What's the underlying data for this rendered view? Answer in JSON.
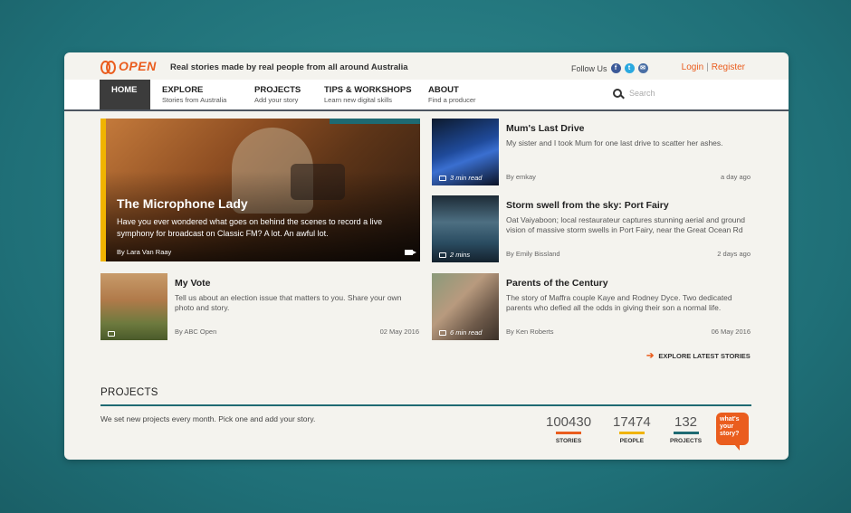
{
  "header": {
    "logo_text": "OPEN",
    "tagline": "Real stories made by real people from all around Australia",
    "follow_label": "Follow Us",
    "social_icons": [
      "facebook-icon",
      "twitter-icon",
      "email-icon"
    ],
    "login": "Login",
    "separator": "|",
    "register": "Register",
    "accent_color": "#ea5d1e"
  },
  "nav": {
    "items": [
      {
        "title": "HOME",
        "sub": ""
      },
      {
        "title": "EXPLORE",
        "sub": "Stories from Australia"
      },
      {
        "title": "PROJECTS",
        "sub": "Add your story"
      },
      {
        "title": "TIPS & WORKSHOPS",
        "sub": "Learn new digital skills"
      },
      {
        "title": "ABOUT",
        "sub": "Find a producer"
      }
    ],
    "search_placeholder": "Search"
  },
  "feature": {
    "title": "The Microphone Lady",
    "description": "Have you ever wondered what goes on behind the scenes to record a live symphony for broadcast on Classic FM? A lot. An awful lot.",
    "byline": "By Lara Van Raay"
  },
  "stories": [
    {
      "title": "Mum's Last Drive",
      "description": "My sister and I took Mum for one last drive to scatter her ashes.",
      "byline": "By emkay",
      "date": "a day ago",
      "badge": "3 min read"
    },
    {
      "title": "Storm swell from the sky: Port Fairy",
      "description": "Oat Vaiyaboon; local restaurateur captures stunning aerial and ground vision of massive storm swells in Port Fairy, near the Great Ocean Rd",
      "byline": "By Emily Bissland",
      "date": "2 days ago",
      "badge": "2 mins"
    },
    {
      "title": "My Vote",
      "description": "Tell us about an election issue that matters to you. Share your own photo and story.",
      "byline": "By ABC Open",
      "date": "02 May 2016",
      "badge": ""
    },
    {
      "title": "Parents of the Century",
      "description": "The story of Maffra couple Kaye and Rodney Dyce. Two dedicated parents who defied all the odds in giving their son a normal life.",
      "byline": "By Ken Roberts",
      "date": "06 May 2016",
      "badge": "6 min read"
    }
  ],
  "explore_latest": "EXPLORE LATEST STORIES",
  "projects": {
    "heading": "PROJECTS",
    "subtitle": "We set new projects every month. Pick one and add your story.",
    "stats": [
      {
        "value": "100430",
        "label": "STORIES",
        "color": "#ea5d1e"
      },
      {
        "value": "17474",
        "label": "PEOPLE",
        "color": "#f0b400"
      },
      {
        "value": "132",
        "label": "PROJECTS",
        "color": "#1e6a72"
      }
    ],
    "badge_text": "what's your story?"
  }
}
